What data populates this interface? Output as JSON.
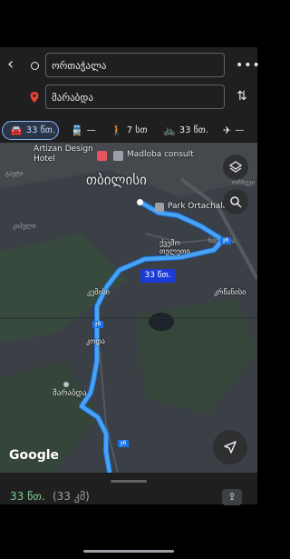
{
  "search": {
    "origin": "ორთაჭალა",
    "destination": "მარაბდა"
  },
  "modes": [
    {
      "name": "car",
      "icon": "car-icon",
      "label": "33 წთ.",
      "selected": true
    },
    {
      "name": "transit",
      "icon": "train-icon",
      "label": "—"
    },
    {
      "name": "walk",
      "icon": "walk-icon",
      "label": "7 სთ"
    },
    {
      "name": "bike",
      "icon": "bike-icon",
      "label": "33 წთ."
    },
    {
      "name": "flight",
      "icon": "plane-icon",
      "label": "—"
    }
  ],
  "map": {
    "labels": {
      "artizan": "Artizan Design\nHotel",
      "madloba": "Madloba consult",
      "tbilisi": "თბილისი",
      "park": "Park Ortachala",
      "qvemo": "ქვემო\nთელეთი",
      "kumisi": "კუმისი",
      "krtsanisi": "კრწანისი",
      "koda": "კოდა",
      "marabda": "მარაბდა",
      "b6a": "ნაცვალა",
      "left_top": "გაუტი",
      "left_mid": "კიპელი",
      "right_top": "ორხევი"
    },
    "route_badge": "33 წთ.",
    "road_shields": [
      "ჯ6",
      "ჯ6",
      "ჯ6"
    ],
    "google": "Google",
    "route_color": "#4aa3f0"
  },
  "summary": {
    "time": "33 წთ.",
    "distance": "(33 კმ)"
  }
}
